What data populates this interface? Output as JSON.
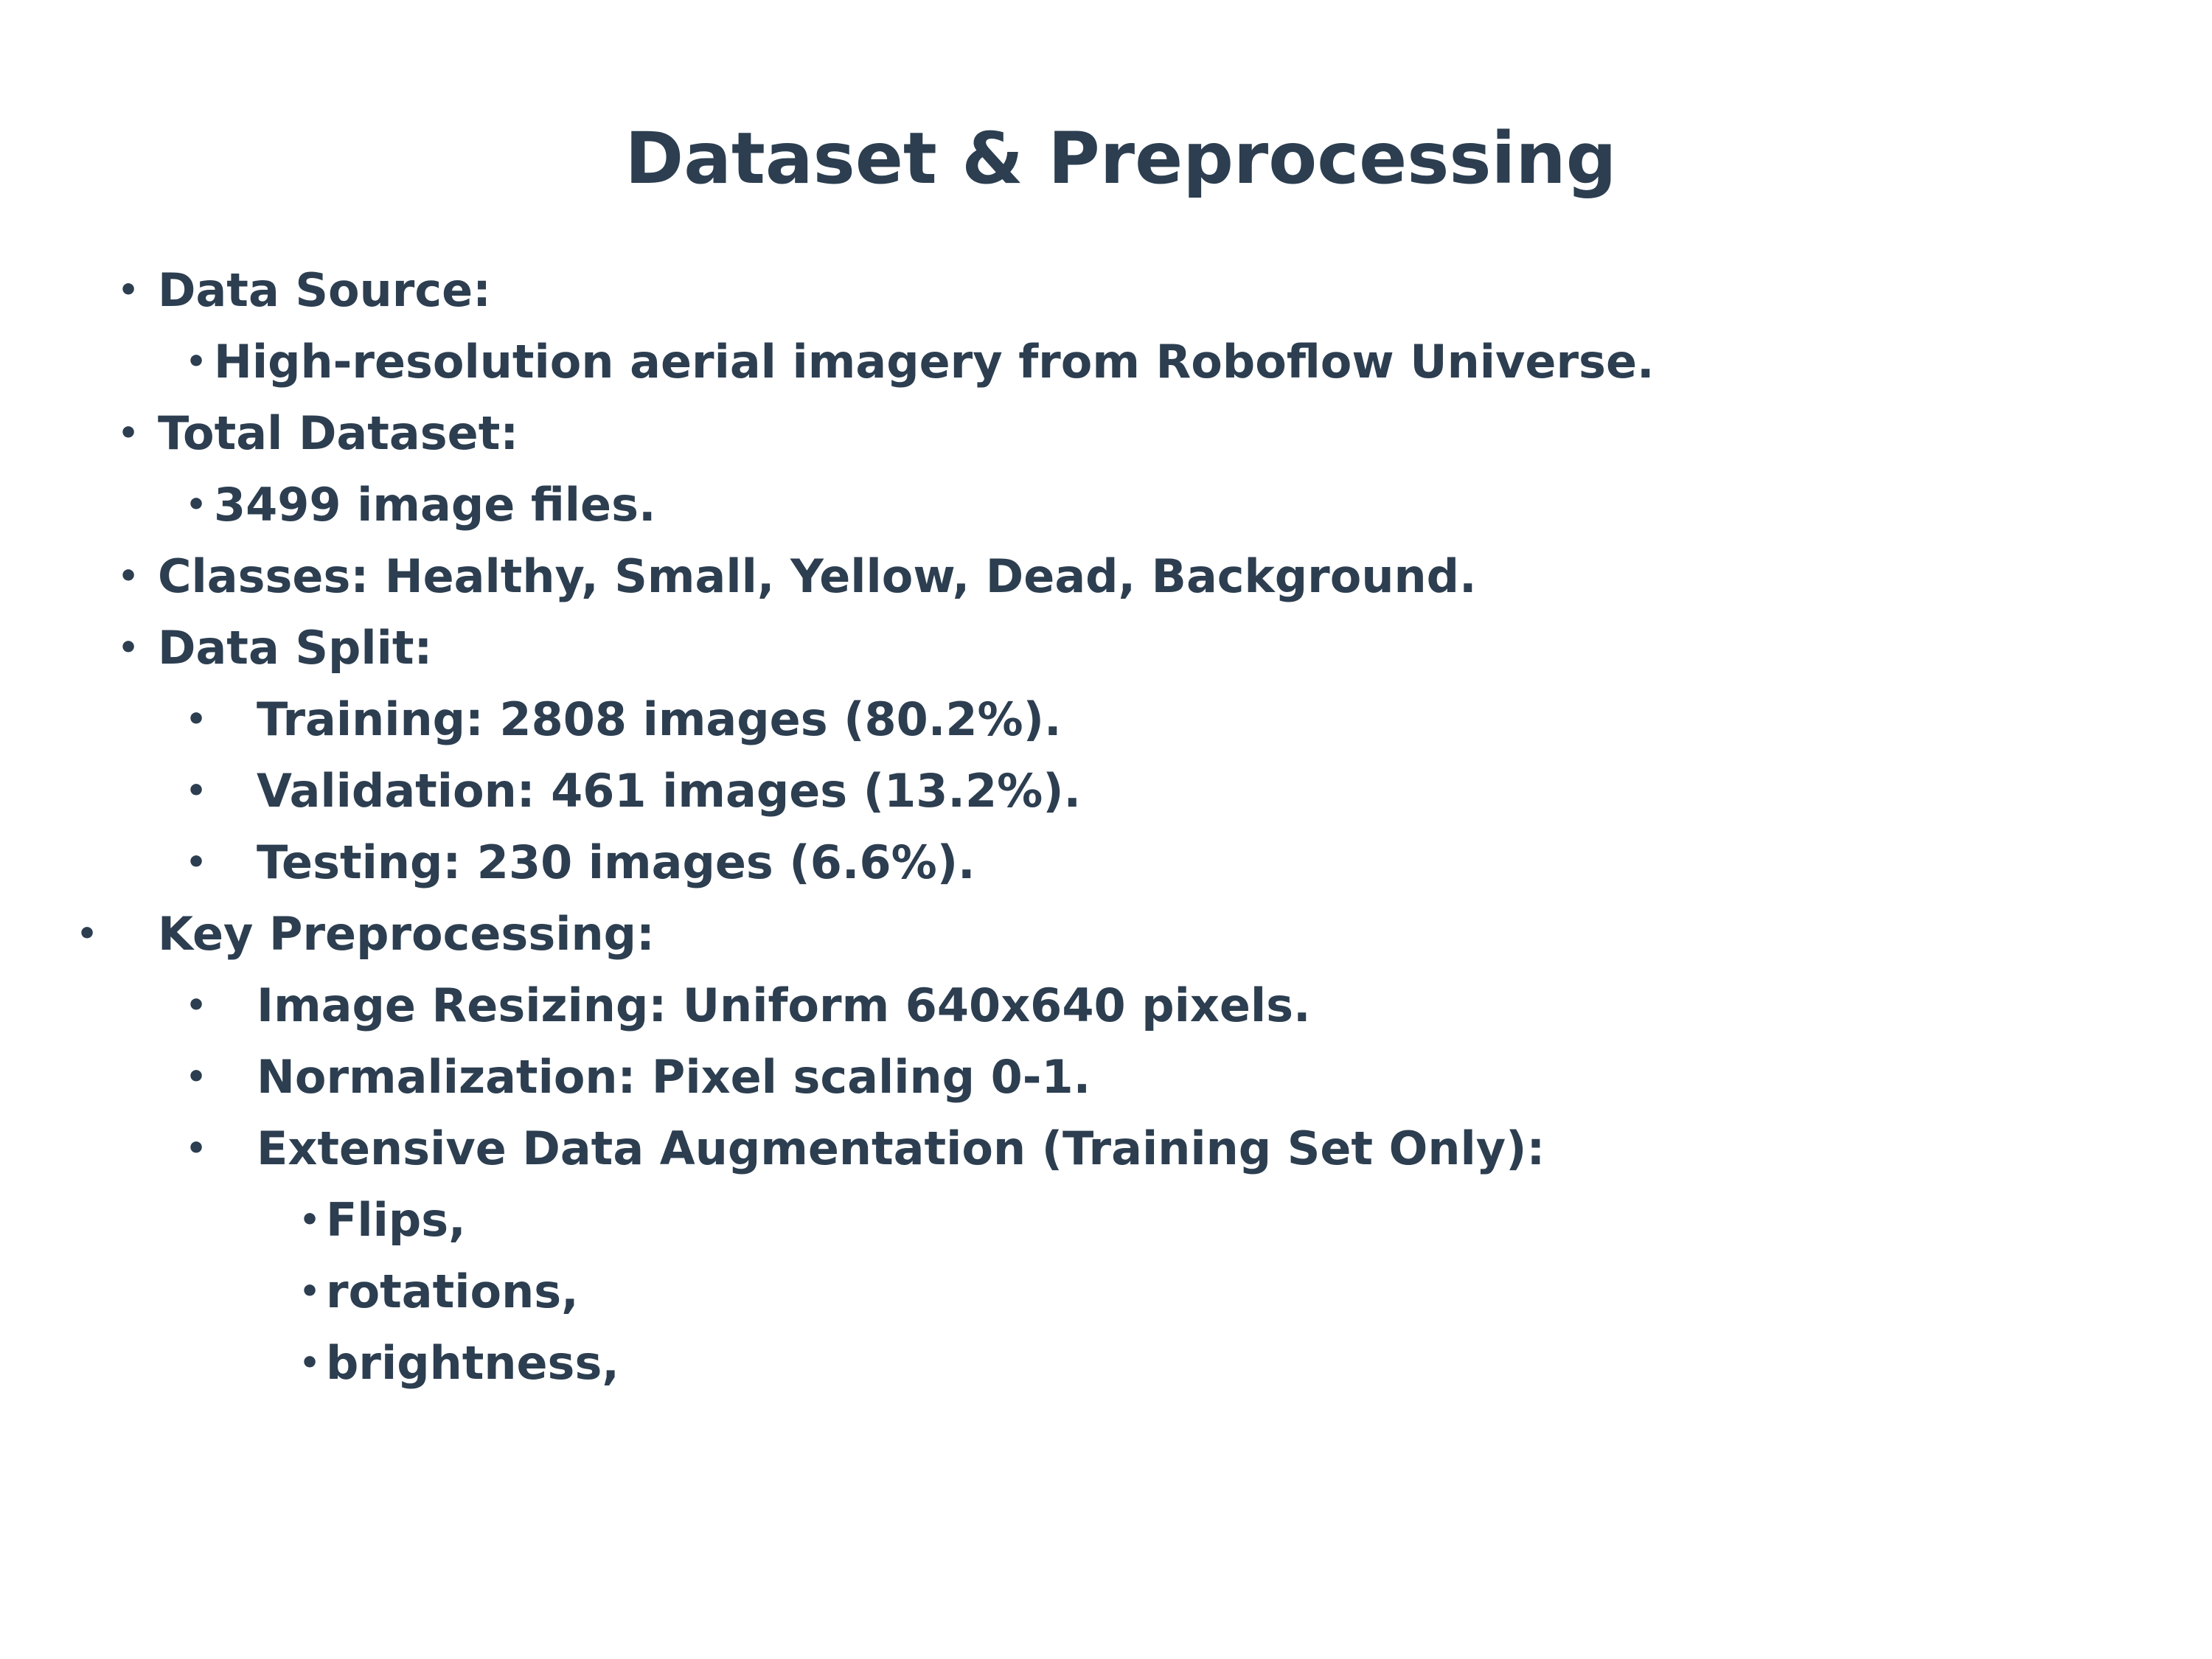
{
  "slide": {
    "title": "Dataset & Preprocessing",
    "items": [
      {
        "text": "Data Source:",
        "bullet": "•"
      },
      {
        "text": "High-resolution aerial imagery from Roboflow Universe.",
        "bullet": "•"
      },
      {
        "text": "Total Dataset:",
        "bullet": "•"
      },
      {
        "text": "3499 image files.",
        "bullet": "•"
      },
      {
        "text": "Classes: Healthy, Small, Yellow, Dead, Background.",
        "bullet": "•"
      },
      {
        "text": "Data Split:",
        "bullet": "•"
      },
      {
        "text": "Training: 2808 images (80.2%).",
        "bullet": "•"
      },
      {
        "text": "Validation: 461 images (13.2%).",
        "bullet": "•"
      },
      {
        "text": "Testing: 230 images (6.6%).",
        "bullet": "•"
      },
      {
        "text": "Key Preprocessing:",
        "bullet": "•"
      },
      {
        "text": "Image Resizing: Uniform 640x640 pixels.",
        "bullet": "•"
      },
      {
        "text": "Normalization: Pixel scaling 0-1.",
        "bullet": "•"
      },
      {
        "text": "Extensive Data Augmentation (Training Set Only):",
        "bullet": "•"
      },
      {
        "text": "Flips,",
        "bullet": "•"
      },
      {
        "text": "rotations,",
        "bullet": "•"
      },
      {
        "text": "brightness,",
        "bullet": "•"
      }
    ]
  },
  "colors": {
    "text": "#2c3e50",
    "background": "#ffffff"
  }
}
